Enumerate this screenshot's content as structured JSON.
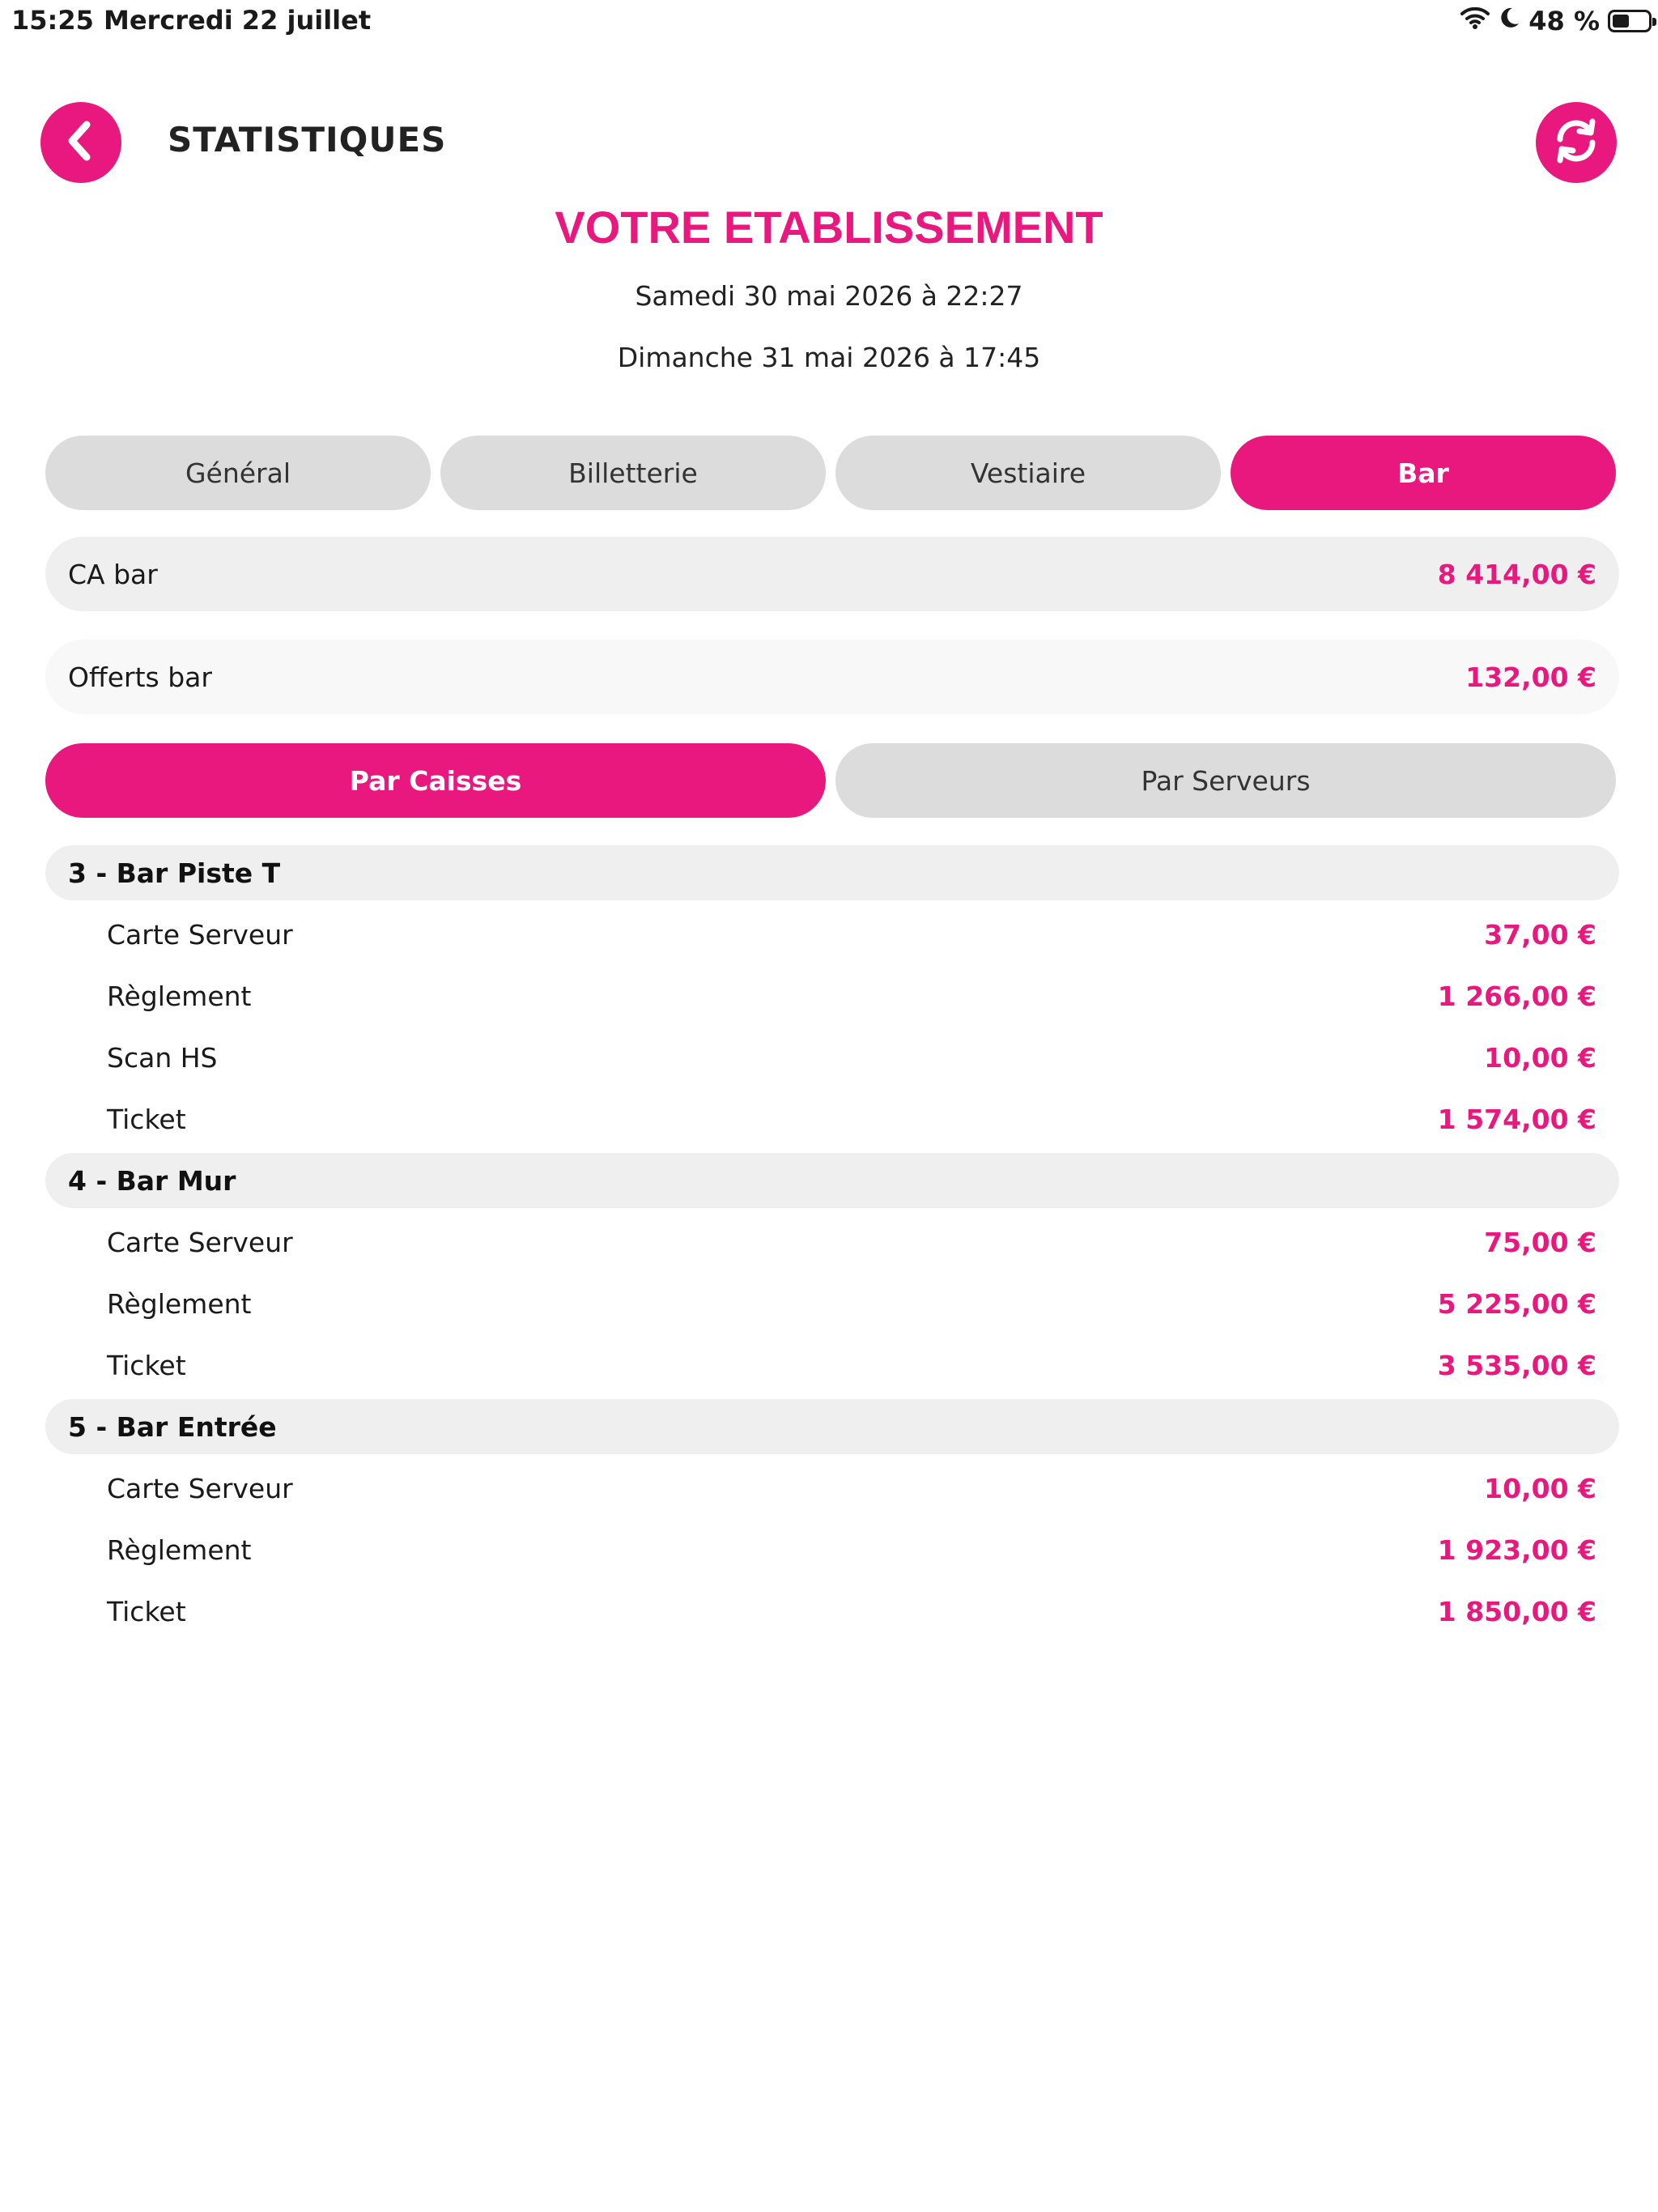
{
  "status_bar": {
    "time": "15:25",
    "date": "Mercredi 22 juillet",
    "battery": "48 %",
    "battery_level": 0.48
  },
  "header": {
    "title": "STATISTIQUES",
    "back_icon": "chevron-left-icon",
    "refresh_icon": "refresh-icon"
  },
  "establishment": {
    "name": "VOTRE ETABLISSEMENT",
    "start": "Samedi 30 mai 2026 à 22:27",
    "end": "Dimanche 31 mai 2026 à 17:45"
  },
  "tabs": [
    {
      "label": "Général",
      "active": false
    },
    {
      "label": "Billetterie",
      "active": false
    },
    {
      "label": "Vestiaire",
      "active": false
    },
    {
      "label": "Bar",
      "active": true
    }
  ],
  "kpis": [
    {
      "label": "CA bar",
      "value": "8 414,00 €"
    },
    {
      "label": "Offerts bar",
      "value": "132,00 €"
    }
  ],
  "subtabs": [
    {
      "label": "Par Caisses",
      "active": true
    },
    {
      "label": "Par Serveurs",
      "active": false
    }
  ],
  "groups": [
    {
      "name": "3 - Bar Piste T",
      "rows": [
        {
          "label": "Carte Serveur",
          "value": "37,00 €"
        },
        {
          "label": "Règlement",
          "value": "1 266,00 €"
        },
        {
          "label": "Scan HS",
          "value": "10,00 €"
        },
        {
          "label": "Ticket",
          "value": "1 574,00 €"
        }
      ]
    },
    {
      "name": "4 - Bar Mur",
      "rows": [
        {
          "label": "Carte Serveur",
          "value": "75,00 €"
        },
        {
          "label": "Règlement",
          "value": "5 225,00 €"
        },
        {
          "label": "Ticket",
          "value": "3 535,00 €"
        }
      ]
    },
    {
      "name": "5 - Bar Entrée",
      "rows": [
        {
          "label": "Carte Serveur",
          "value": "10,00 €"
        },
        {
          "label": "Règlement",
          "value": "1 923,00 €"
        },
        {
          "label": "Ticket",
          "value": "1 850,00 €"
        }
      ]
    }
  ],
  "colors": {
    "accent": "#e8187f",
    "pill_inactive": "#dcdcdc",
    "row_bg": "#efefef"
  }
}
